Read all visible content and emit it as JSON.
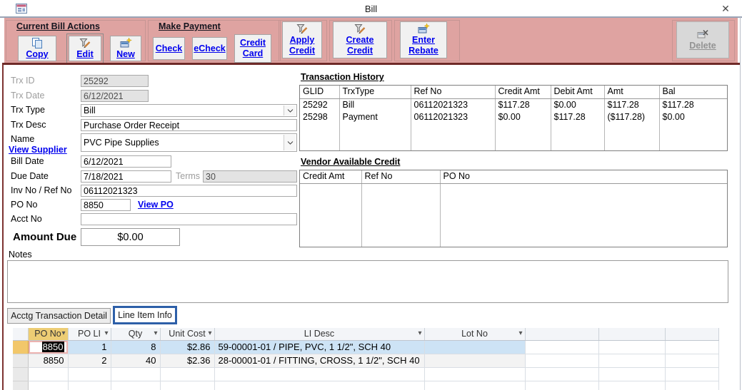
{
  "window": {
    "title": "Bill",
    "close_glyph": "✕"
  },
  "toolbar": {
    "sections": {
      "current_bill_actions": "Current Bill Actions",
      "make_payment": "Make Payment"
    },
    "buttons": {
      "copy": "Copy",
      "edit": "Edit",
      "new": "New",
      "check": "Check",
      "echeck": "eCheck",
      "credit_card": "Credit Card",
      "apply_credit": "Apply Credit",
      "create_credit": "Create Credit",
      "enter_rebate": "Enter Rebate",
      "delete": "Delete"
    }
  },
  "form": {
    "trx_id": {
      "label": "Trx ID",
      "value": "25292"
    },
    "trx_date": {
      "label": "Trx Date",
      "value": "6/12/2021"
    },
    "trx_type": {
      "label": "Trx Type",
      "value": "Bill"
    },
    "trx_desc": {
      "label": "Trx Desc",
      "value": "Purchase Order Receipt"
    },
    "name": {
      "label": "Name",
      "value": "PVC Pipe Supplies",
      "link": "View Supplier"
    },
    "bill_date": {
      "label": "Bill Date",
      "value": "6/12/2021"
    },
    "due_date": {
      "label": "Due Date",
      "value": "7/18/2021"
    },
    "terms": {
      "label": "Terms",
      "value": "30"
    },
    "inv_no": {
      "label": "Inv No / Ref No",
      "value": "06112021323"
    },
    "po_no": {
      "label": "PO No",
      "value": "8850",
      "link": "View PO"
    },
    "acct_no": {
      "label": "Acct No",
      "value": ""
    },
    "amount_due": {
      "label": "Amount Due",
      "value": "$0.00"
    },
    "notes_label": "Notes",
    "notes_value": ""
  },
  "transaction_history": {
    "title": "Transaction History",
    "columns": [
      "GLID",
      "TrxType",
      "Ref No",
      "Credit Amt",
      "Debit Amt",
      "Amt",
      "Bal"
    ],
    "rows": [
      [
        "25292",
        "Bill",
        "06112021323",
        "$117.28",
        "$0.00",
        "$117.28",
        "$117.28"
      ],
      [
        "25298",
        "Payment",
        "06112021323",
        "$0.00",
        "$117.28",
        "($117.28)",
        "$0.00"
      ]
    ]
  },
  "vendor_available_credit": {
    "title": "Vendor Available Credit",
    "columns": [
      "Credit Amt",
      "Ref No",
      "PO No"
    ],
    "rows": []
  },
  "tabs": {
    "acctg": "Acctg Transaction Detail",
    "line_item": "Line Item Info"
  },
  "line_items": {
    "columns": [
      "PO No",
      "PO LI",
      "Qty",
      "Unit Cost",
      "LI Desc",
      "Lot No"
    ],
    "rows": [
      [
        "8850",
        "1",
        "8",
        "$2.86",
        "59-00001-01 / PIPE, PVC, 1 1/2\", SCH 40",
        ""
      ],
      [
        "8850",
        "2",
        "40",
        "$2.36",
        "28-00001-01 / FITTING, CROSS, 1 1/2\", SCH 40",
        ""
      ]
    ]
  },
  "colors": {
    "toolbar_bg": "#dfa3a1",
    "toolbar_bottom_border": "#6e2a28",
    "selected_row": "#cde3f5",
    "record_selector_amber": "#f2c76a",
    "sorted_column_header": "#edcd74",
    "hyperlink_blue": "#0000ee",
    "active_tab_border": "#2d5fa8"
  }
}
